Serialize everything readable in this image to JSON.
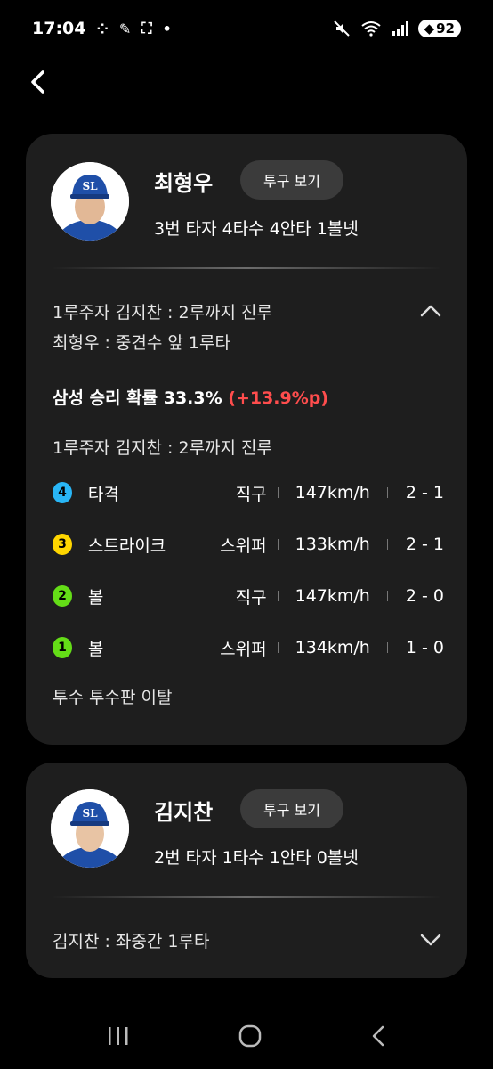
{
  "status_bar": {
    "time": "17:04",
    "left_icons": [
      "grid-icon",
      "wrench-icon",
      "screenshot-icon",
      "dot-icon"
    ],
    "right_icons": [
      "mute-icon",
      "wifi-icon",
      "signal-icon"
    ],
    "battery": "92"
  },
  "cards": [
    {
      "player_name": "최형우",
      "pitch_button_label": "투구 보기",
      "stats": "3번 타자  4타수 4안타 1볼넷",
      "play_line1": "1루주자 김지찬 : 2루까지 진루",
      "play_line2": "최형우 : 중견수 앞 1루타",
      "win_prob_label": "삼성 승리 확률 33.3%",
      "win_prob_change": "(+13.9%p)",
      "runner_event": "1루주자 김지찬 : 2루까지 진루",
      "pitches": [
        {
          "num": "4",
          "color": "#29b6f6",
          "result": "타격",
          "type": "직구",
          "speed": "147km/h",
          "count": "2 - 1"
        },
        {
          "num": "3",
          "color": "#ffd600",
          "result": "스트라이크",
          "type": "스위퍼",
          "speed": "133km/h",
          "count": "2 - 1"
        },
        {
          "num": "2",
          "color": "#64dd17",
          "result": "볼",
          "type": "직구",
          "speed": "147km/h",
          "count": "2 - 0"
        },
        {
          "num": "1",
          "color": "#64dd17",
          "result": "볼",
          "type": "스위퍼",
          "speed": "134km/h",
          "count": "1 - 0"
        }
      ],
      "footer_event": "투수 투수판 이탈"
    },
    {
      "player_name": "김지찬",
      "pitch_button_label": "투구 보기",
      "stats": "2번 타자  1타수 1안타 0볼넷",
      "play_line1": "김지찬 : 좌중간 1루타"
    }
  ],
  "logo_text": "SL",
  "colors": {
    "background": "#000000",
    "card": "#1e1e1e",
    "button": "#3b3b3b",
    "accent_red": "#ff4d4d",
    "team_blue": "#1f4fa8"
  }
}
